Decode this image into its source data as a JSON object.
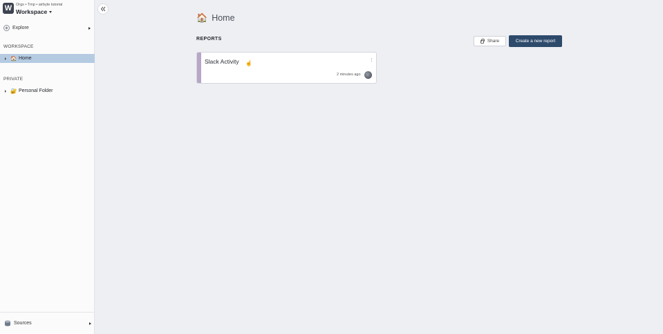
{
  "sidebar": {
    "org_path": "Orgs • Tmp • airbyte tutorial",
    "workspace_name": "Workspace",
    "logo_letter": "W",
    "explore_label": "Explore",
    "workspace_section": "WORKSPACE",
    "workspace_items": [
      {
        "label": "Home",
        "emoji": "🏠",
        "active": true
      }
    ],
    "private_section": "PRIVATE",
    "private_items": [
      {
        "label": "Personal Folder",
        "emoji": "🔐",
        "active": false
      }
    ],
    "sources_label": "Sources"
  },
  "main": {
    "page_emoji": "🏠",
    "page_title": "Home",
    "reports_heading": "REPORTS",
    "share_label": "Share",
    "create_label": "Create a new report",
    "reports": [
      {
        "title": "Slack Activity",
        "time": "2 minutes ago"
      }
    ]
  },
  "icons": {
    "collapse": "double-chevron-left-icon",
    "explore": "compass-icon",
    "sources": "database-icon",
    "share": "lock-icon"
  },
  "colors": {
    "accent": "#2d4a6b",
    "active_nav": "#b5cbe2",
    "card_stripe": "#b7a6c7",
    "background": "#eeeff3"
  }
}
